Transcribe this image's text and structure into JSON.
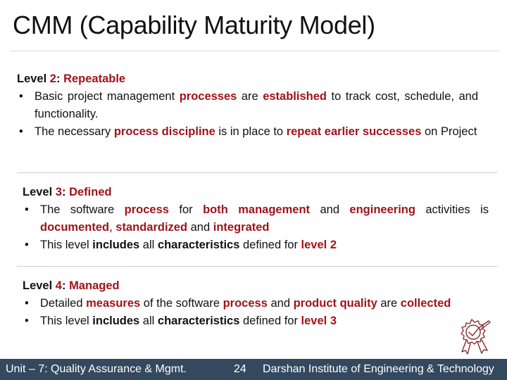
{
  "slide": {
    "title": "CMM (Capability Maturity Model)",
    "accent_color": "#a01319",
    "footer_color": "#34495e"
  },
  "levels": [
    {
      "prefix": "Level ",
      "number": "2",
      "colon": ": ",
      "name": "Repeatable",
      "bullets": [
        [
          {
            "t": "Basic project management ",
            "s": "n"
          },
          {
            "t": "processes",
            "s": "r"
          },
          {
            "t": " are ",
            "s": "n"
          },
          {
            "t": "established",
            "s": "r"
          },
          {
            "t": " to track cost, schedule, and functionality.",
            "s": "n"
          }
        ],
        [
          {
            "t": "The necessary ",
            "s": "n"
          },
          {
            "t": "process discipline",
            "s": "r"
          },
          {
            "t": " is in place to ",
            "s": "n"
          },
          {
            "t": "repeat earlier successes",
            "s": "r"
          },
          {
            "t": " on Project",
            "s": "n"
          }
        ]
      ]
    },
    {
      "prefix": "Level ",
      "number": "3",
      "colon": ": ",
      "name": "Defined",
      "bullets": [
        [
          {
            "t": "The software ",
            "s": "n"
          },
          {
            "t": "process",
            "s": "r"
          },
          {
            "t": " for ",
            "s": "n"
          },
          {
            "t": "both management",
            "s": "r"
          },
          {
            "t": " and ",
            "s": "n"
          },
          {
            "t": "engineering",
            "s": "r"
          },
          {
            "t": " activities is ",
            "s": "n"
          },
          {
            "t": "documented",
            "s": "r"
          },
          {
            "t": ", ",
            "s": "n"
          },
          {
            "t": "standardized",
            "s": "r"
          },
          {
            "t": " and ",
            "s": "n"
          },
          {
            "t": "integrated",
            "s": "r"
          }
        ],
        [
          {
            "t": "This level ",
            "s": "n"
          },
          {
            "t": "includes",
            "s": "b"
          },
          {
            "t": " all ",
            "s": "n"
          },
          {
            "t": "characteristics",
            "s": "b"
          },
          {
            "t": " defined for ",
            "s": "n"
          },
          {
            "t": "level 2",
            "s": "r"
          }
        ]
      ]
    },
    {
      "prefix": "Level ",
      "number": "4",
      "colon": ": ",
      "name": "Managed",
      "bullets": [
        [
          {
            "t": "Detailed ",
            "s": "n"
          },
          {
            "t": "measures",
            "s": "r"
          },
          {
            "t": " of the software ",
            "s": "n"
          },
          {
            "t": "process",
            "s": "r"
          },
          {
            "t": " and ",
            "s": "n"
          },
          {
            "t": "product quality",
            "s": "r"
          },
          {
            "t": " are ",
            "s": "n"
          },
          {
            "t": "collected",
            "s": "r"
          }
        ],
        [
          {
            "t": "This level ",
            "s": "n"
          },
          {
            "t": "includes",
            "s": "b"
          },
          {
            "t": " all ",
            "s": "n"
          },
          {
            "t": "characteristics",
            "s": "b"
          },
          {
            "t": " defined for ",
            "s": "n"
          },
          {
            "t": "level 3",
            "s": "r"
          }
        ]
      ]
    }
  ],
  "decoration": {
    "icon": "award-badge-icon"
  },
  "footer": {
    "unit": "Unit – 7: Quality Assurance & Mgmt.",
    "page": "24",
    "institute": "Darshan Institute of Engineering & Technology"
  }
}
